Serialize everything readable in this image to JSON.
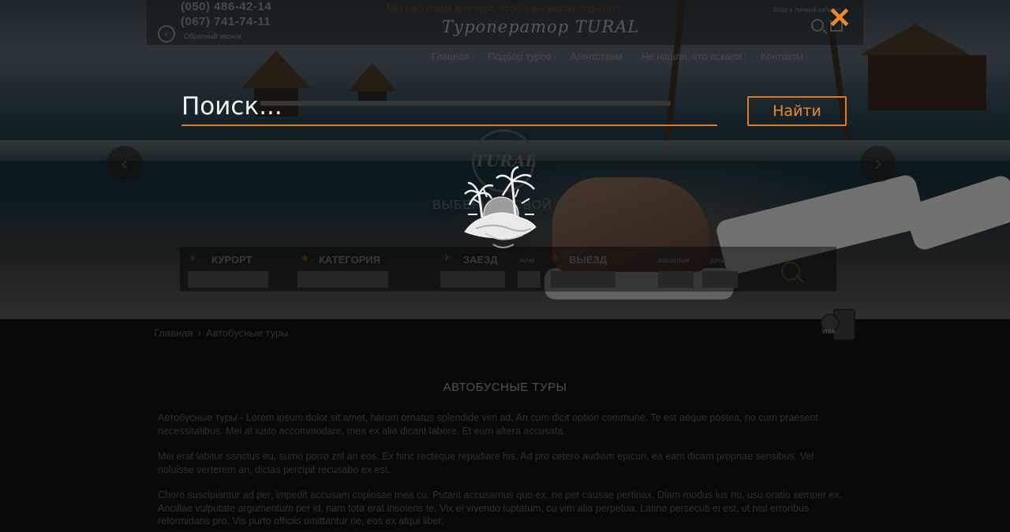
{
  "header": {
    "phones": [
      "(050) 486-42-14",
      "(067) 741-74-11"
    ],
    "callback_label": "Обратный звонок",
    "promo_line": "Мы работаем для того, чтобы вы могли отдыхать",
    "logo_text": "Туроператор TURAL",
    "login_label": "Вход в личный кабинет"
  },
  "nav": {
    "items": [
      {
        "label": "Главная"
      },
      {
        "label": "Подбор туров"
      },
      {
        "label": "Агентствам"
      },
      {
        "label": "Не нашли, что искали"
      },
      {
        "label": "Контакты"
      }
    ]
  },
  "hero": {
    "brand": "TURAL",
    "slogan": "ВЫБЕРИТЕ СВОЙ ОТПУСК",
    "prev_arrow": "‹",
    "next_arrow": "›"
  },
  "filters": {
    "resort": "КУРОРТ",
    "category": "КАТЕГОРИЯ",
    "checkin": "ЗАЕЗД",
    "nights": "ночи",
    "checkout": "ВЫЕЗД",
    "adults": "взрослые",
    "children": "дети"
  },
  "breadcrumb": {
    "home": "Главная",
    "separator": "›",
    "current": "Автобусные туры"
  },
  "visa_tag": "VISA",
  "content": {
    "title": "АВТОБУСНЫЕ ТУРЫ",
    "paragraphs": [
      "Автобусные туры - Lorem ipsum dolor sit amet, harum ornatus splendide vim ad. An cum dicit option commune. Te est aeque postea, no cum praesent necessitatibus. Mei at iusto accommodare, mea ex alia dicant labore. Et eum altera accusata.",
      "Mei erat labitur sanctus eu, sumo porro zril an eos. Ex hinc recteque repudiare his. Ad pro cetero audiam epicuri, ea eam dicam propriae sensibus. Vel noluisse verterem an, dictas percipit recusabo ex est.",
      "Choro suscipiantur ad per, impedit accusam copiosae mea cu. Putant accusamus quo ex, ne per causae pertinax. Diam modus ius no, usu oratio semper ex. Ancillae vulputate argumentum per id, nam tota erat insolens te. Vix ei vivendo luptatum, cu vim alia perpetua. Latine persecuti ei est, ut nisl erroribus reformidans pro. Vis purto officiis omittantur ne, eos ex atqui liber."
    ]
  },
  "search_overlay": {
    "placeholder": "Поиск...",
    "find_label": "Найти",
    "close_label": "✕"
  },
  "colors": {
    "accent": "#e27a22",
    "overlay": "#000000"
  }
}
